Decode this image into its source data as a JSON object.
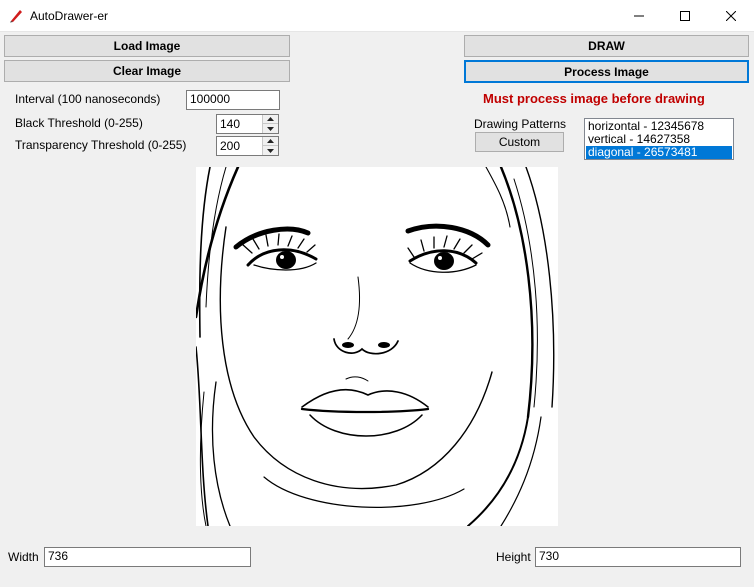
{
  "window": {
    "title": "AutoDrawer-er"
  },
  "buttons": {
    "load_image": "Load Image",
    "clear_image": "Clear Image",
    "draw": "DRAW",
    "process_image": "Process Image",
    "custom": "Custom"
  },
  "fields": {
    "interval_label": "Interval (100 nanoseconds)",
    "interval_value": "100000",
    "black_threshold_label": "Black Threshold (0-255)",
    "black_threshold_value": "140",
    "transparency_threshold_label": "Transparency Threshold (0-255)",
    "transparency_threshold_value": "200",
    "width_label": "Width",
    "width_value": "736",
    "height_label": "Height",
    "height_value": "730"
  },
  "warning": "Must process image before drawing",
  "patterns": {
    "label": "Drawing Patterns",
    "items": [
      {
        "text": "horizontal - 12345678",
        "selected": false
      },
      {
        "text": "vertical - 14627358",
        "selected": false
      },
      {
        "text": "diagonal - 26573481",
        "selected": true
      }
    ]
  },
  "colors": {
    "warning": "#c00000",
    "selection": "#0078d7",
    "focus_border": "#0078d7"
  },
  "icons": [
    "app-pen-icon",
    "minimize-icon",
    "maximize-icon",
    "close-icon",
    "spin-up-icon",
    "spin-down-icon"
  ]
}
